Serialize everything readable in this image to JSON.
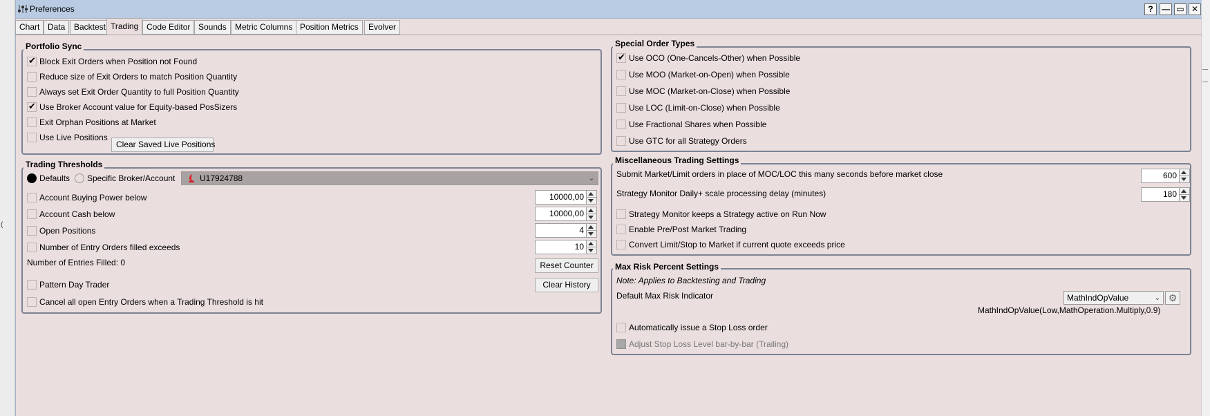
{
  "window": {
    "title": "Preferences"
  },
  "titlebar_buttons": {
    "help": "?",
    "minimize": "—",
    "maximize": "▭",
    "close": "✕"
  },
  "tabs": [
    "Chart",
    "Data",
    "Backtest",
    "Trading",
    "Code Editor",
    "Sounds",
    "Metric Columns",
    "Position Metrics",
    "Evolver"
  ],
  "active_tab": "Trading",
  "portfolio_sync": {
    "title": "Portfolio Sync",
    "options": [
      {
        "label": "Block Exit Orders when Position not Found",
        "checked": true
      },
      {
        "label": "Reduce size of Exit Orders to match Position Quantity",
        "checked": false
      },
      {
        "label": "Always set Exit Order Quantity to full Position Quantity",
        "checked": false
      },
      {
        "label": "Use Broker Account value for Equity-based PosSizers",
        "checked": true
      },
      {
        "label": "Exit Orphan Positions at Market",
        "checked": false
      },
      {
        "label": "Use Live Positions",
        "checked": false
      }
    ],
    "clear_button": "Clear Saved Live Positions"
  },
  "trading_thresholds": {
    "title": "Trading Thresholds",
    "radio_defaults": "Defaults",
    "radio_specific": "Specific Broker/Account",
    "account": "U17924788",
    "rows": [
      {
        "label": "Account Buying Power below",
        "value": "10000,00"
      },
      {
        "label": "Account Cash below",
        "value": "10000,00"
      },
      {
        "label": "Open Positions",
        "value": "4"
      },
      {
        "label": "Number of Entry Orders filled exceeds",
        "value": "10"
      }
    ],
    "entries_filled": "Number of Entries Filled: 0",
    "reset_button": "Reset Counter",
    "pattern_day_trader": "Pattern Day Trader",
    "clear_history_button": "Clear History",
    "cancel_all": "Cancel all open Entry Orders when a Trading Threshold is hit"
  },
  "special_order_types": {
    "title": "Special Order Types",
    "options": [
      {
        "label": "Use OCO (One-Cancels-Other) when Possible",
        "checked": true
      },
      {
        "label": "Use MOO (Market-on-Open) when Possible",
        "checked": false
      },
      {
        "label": "Use MOC (Market-on-Close) when Possible",
        "checked": false
      },
      {
        "label": "Use LOC (Limit-on-Close) when Possible",
        "checked": false
      },
      {
        "label": "Use Fractional Shares when Possible",
        "checked": false
      },
      {
        "label": "Use GTC for all Strategy Orders",
        "checked": false
      }
    ]
  },
  "misc": {
    "title": "Miscellaneous Trading Settings",
    "submit_label": "Submit Market/Limit orders in place of MOC/LOC this many seconds before market close",
    "submit_value": "600",
    "delay_label": "Strategy Monitor Daily+ scale processing delay (minutes)",
    "delay_value": "180",
    "options": [
      {
        "label": "Strategy Monitor keeps a Strategy active on Run Now",
        "checked": false
      },
      {
        "label": "Enable Pre/Post Market Trading",
        "checked": false
      },
      {
        "label": "Convert Limit/Stop to Market if current quote exceeds price",
        "checked": false
      }
    ]
  },
  "max_risk": {
    "title": "Max Risk Percent Settings",
    "note": "Note: Applies to Backtesting and Trading",
    "indicator_label": "Default Max Risk Indicator",
    "indicator_value": "MathIndOpValue",
    "indicator_expr": "MathIndOpValue(Low,MathOperation.Multiply,0.9)",
    "auto_stop": "Automatically issue a Stop Loss order",
    "trailing": "Adjust Stop Loss Level bar-by-bar (Trailing)"
  },
  "colors": {
    "panel_bg": "#ebdede",
    "titlebar_bg": "#b8cbe2",
    "group_border": "#7b8394"
  }
}
